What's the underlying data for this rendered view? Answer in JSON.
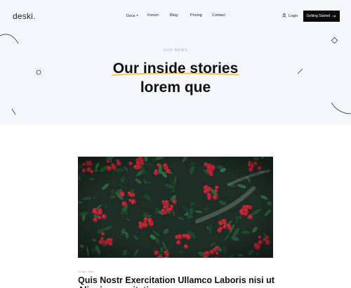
{
  "header": {
    "logo": "deski.",
    "nav": [
      {
        "label": "Docs",
        "has_dropdown": true
      },
      {
        "label": "Forum"
      },
      {
        "label": "Blog"
      },
      {
        "label": "Pricing"
      },
      {
        "label": "Contact"
      }
    ],
    "login_label": "Login",
    "cta_label": "Getting Started"
  },
  "hero": {
    "kicker": "OUR NEWS",
    "title_line1": "Our inside stories",
    "title_line2": "lorem que",
    "underline_color": "#f3c94b"
  },
  "post": {
    "date": "23 Apr, 2020",
    "title": "Quis Nostr Exercitation Ullamco Laboris nisi ut Aliquip exercitation"
  },
  "colors": {
    "hero_bg": "#f4f6fb",
    "cta_bg": "#0b0b0b",
    "accent": "#f3c94b",
    "berry": "#b3202f"
  },
  "icons": {
    "login": "user-icon",
    "cta": "arrow-right-icon",
    "dropdown": "chevron-down-icon"
  }
}
